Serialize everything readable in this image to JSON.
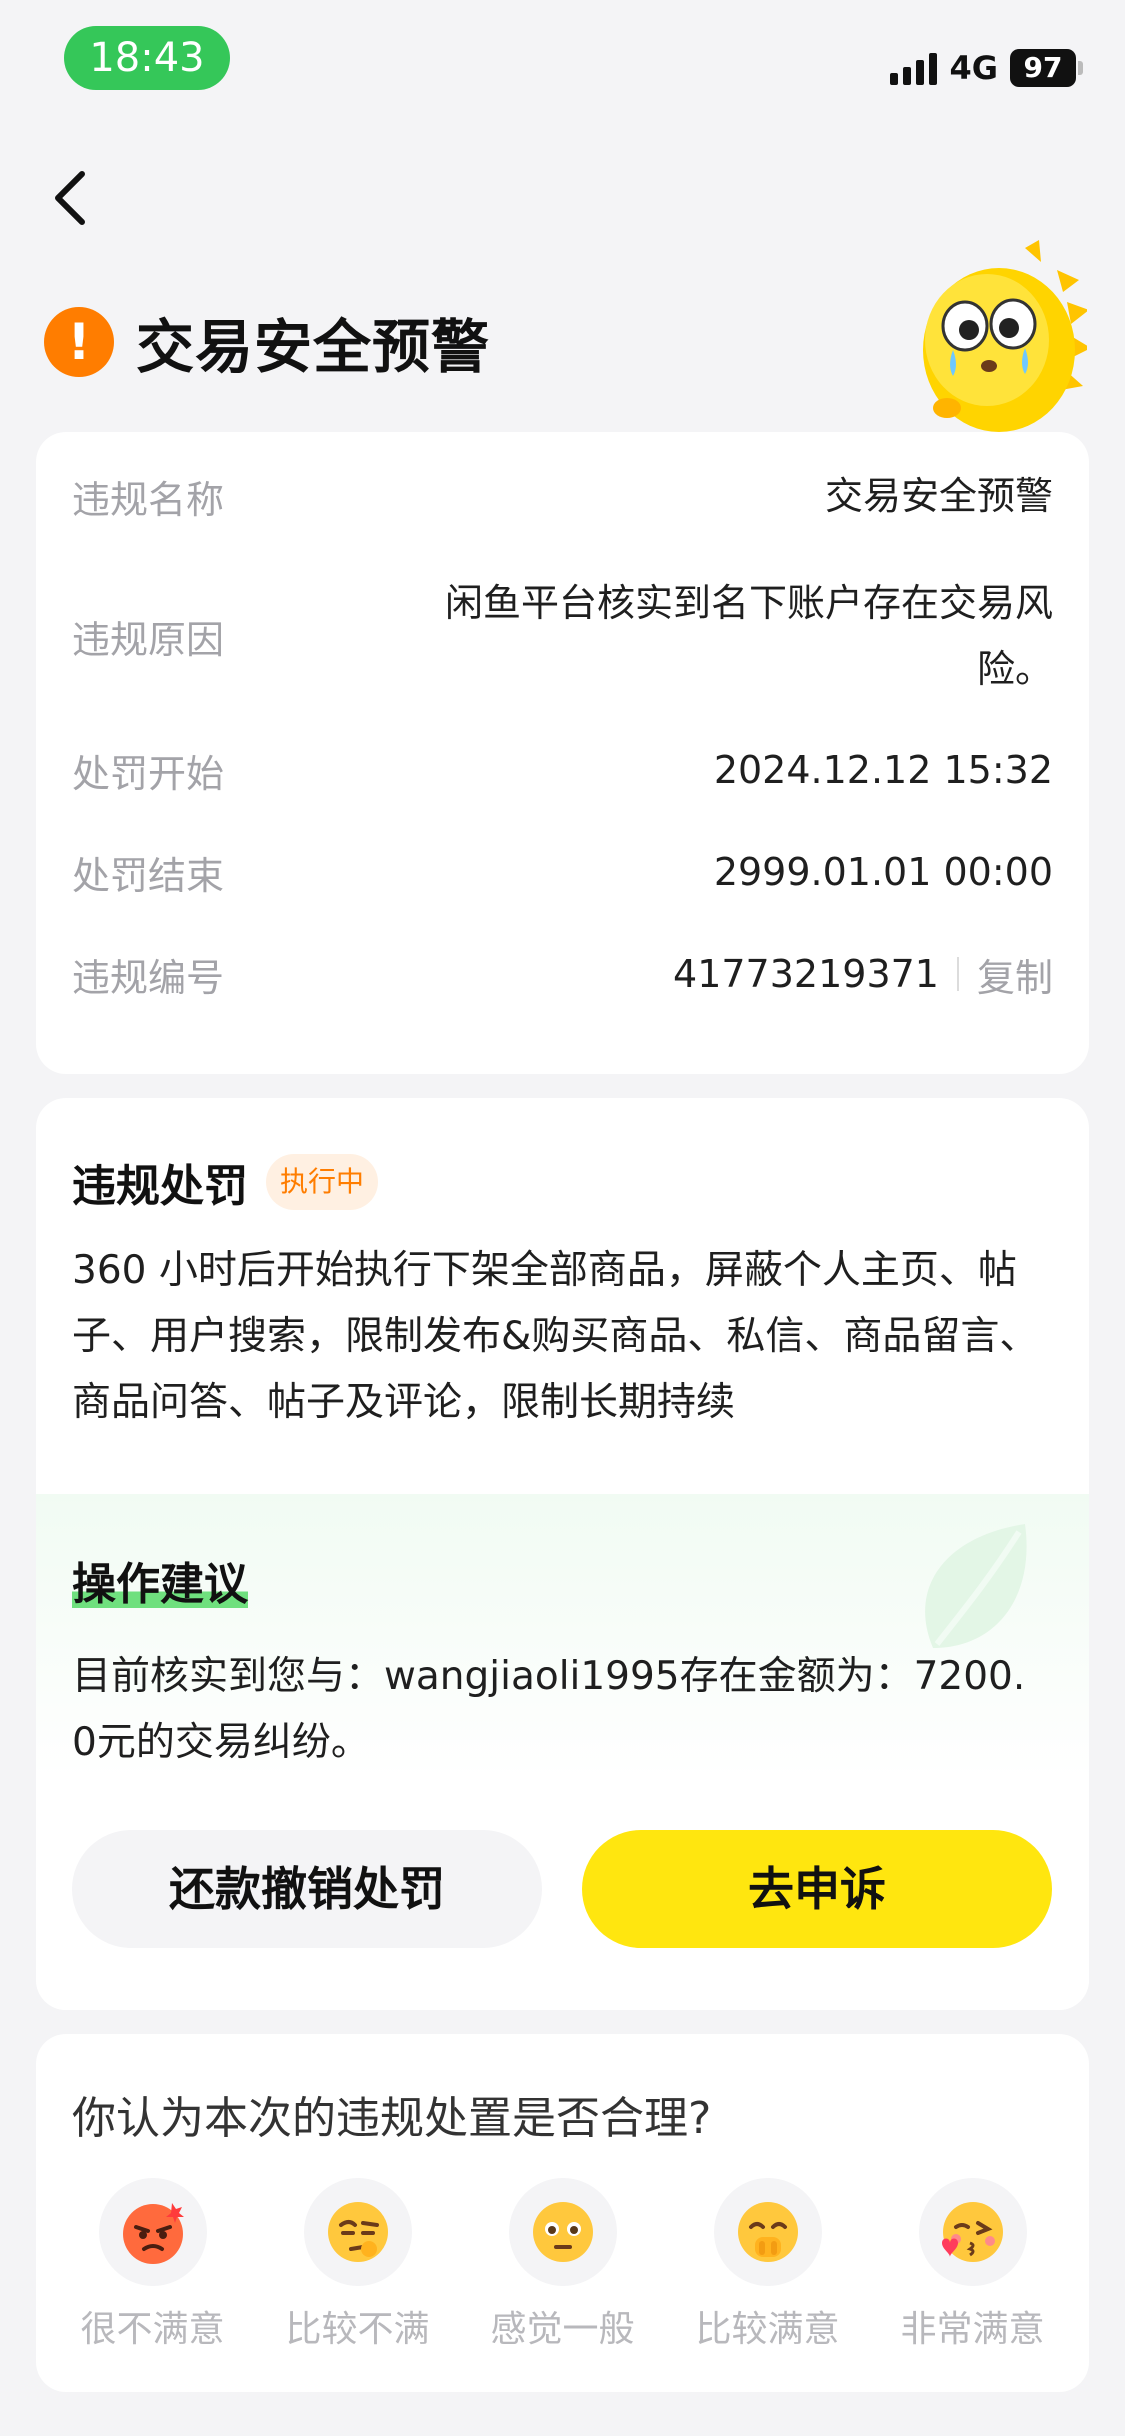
{
  "status_bar": {
    "time": "18:43",
    "network": "4G",
    "battery": "97"
  },
  "header": {
    "title": "交易安全预警"
  },
  "info": {
    "rows": [
      {
        "label": "违规名称",
        "value": "交易安全预警"
      },
      {
        "label": "违规原因",
        "value": "闲鱼平台核实到名下账户存在交易风险。"
      },
      {
        "label": "处罚开始",
        "value": "2024.12.12 15:32"
      },
      {
        "label": "处罚结束",
        "value": "2999.01.01 00:00"
      },
      {
        "label": "违规编号",
        "value": "41773219371"
      }
    ],
    "copy_label": "复制"
  },
  "penalty": {
    "title": "违规处罚",
    "badge": "执行中",
    "text": "360 小时后开始执行下架全部商品，屏蔽个人主页、帖子、用户搜索，限制发布&购买商品、私信、商品留言、商品问答、帖子及评论，限制长期持续"
  },
  "advice": {
    "title": "操作建议",
    "text": "目前核实到您与：wangjiaoli1995存在金额为：7200.0元的交易纠纷。"
  },
  "actions": {
    "repay_label": "还款撤销处罚",
    "appeal_label": "去申诉"
  },
  "survey": {
    "question": "你认为本次的违规处置是否合理?",
    "options": [
      {
        "label": "很不满意",
        "icon": "angry-face-icon"
      },
      {
        "label": "比较不满",
        "icon": "skeptical-face-icon"
      },
      {
        "label": "感觉一般",
        "icon": "neutral-face-icon"
      },
      {
        "label": "比较满意",
        "icon": "giggle-face-icon"
      },
      {
        "label": "非常满意",
        "icon": "kiss-face-icon"
      }
    ]
  },
  "colors": {
    "accent_yellow": "#ffe60f",
    "warning_orange": "#ff7d00",
    "status_green": "#35c759",
    "advice_green": "#6fe07e"
  }
}
